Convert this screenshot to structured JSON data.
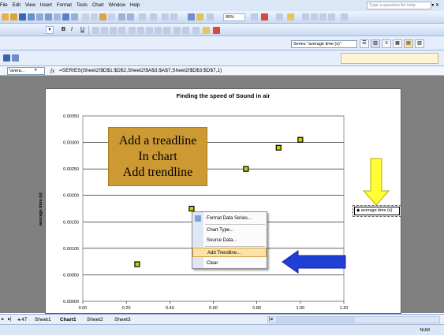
{
  "menu": [
    "File",
    "Edit",
    "View",
    "Insert",
    "Format",
    "Tools",
    "Chart",
    "Window",
    "Help"
  ],
  "help_box": {
    "placeholder": "Type a question for help"
  },
  "toolbar": {
    "zoom": "85%",
    "font_drop": "▾",
    "format_buttons": [
      "B",
      "I",
      "U"
    ],
    "series_select": "Series \"average time (s)\"",
    "name_box": "\"avera...",
    "fx": "fx",
    "formula": "=SERIES(Sheet2!$D$1:$D$2,Sheet2!$A$3:$A$7,Sheet2!$D$3:$D$7,1)"
  },
  "chart": {
    "title": "Finding the speed of Sound in air",
    "y_label": "average time (s)",
    "legend": "average time (s)"
  },
  "chart_data": {
    "type": "scatter",
    "title": "Finding the speed of Sound in air",
    "xlabel": "",
    "ylabel": "average time (s)",
    "xlim": [
      0,
      1.2
    ],
    "ylim": [
      0,
      0.0035
    ],
    "x_ticks": [
      "0.00",
      "0.20",
      "0.40",
      "0.60",
      "0.80",
      "1.00",
      "1.20"
    ],
    "y_ticks": [
      "0.00000",
      "0.00050",
      "0.00100",
      "0.00150",
      "0.00200",
      "0.00250",
      "0.00300",
      "0.00350"
    ],
    "grid": "horizontal",
    "legend_position": "right",
    "series": [
      {
        "name": "average time (s)",
        "x": [
          0.25,
          0.5,
          0.75,
          0.9,
          1.0
        ],
        "y": [
          0.0007,
          0.00175,
          0.0025,
          0.0029,
          0.00305
        ]
      }
    ]
  },
  "callout": [
    "Add a treadline",
    "In chart",
    "Add trendline"
  ],
  "context_menu": [
    "Format Data Series...",
    "Chart Type...",
    "Source Data...",
    "Add Trendline...",
    "Clear"
  ],
  "tabs": {
    "count": "47",
    "items": [
      "Sheet1",
      "Chart1",
      "Sheet2",
      "Sheet3"
    ],
    "active": "Chart1"
  },
  "status": {
    "mode": "NUM"
  },
  "colors": {
    "callout": "#cc9933",
    "arrow_yellow": "#ffff33",
    "arrow_blue": "#1f3fd6",
    "marker": "#cccc00",
    "menu_highlight": "#fbe3a8"
  }
}
